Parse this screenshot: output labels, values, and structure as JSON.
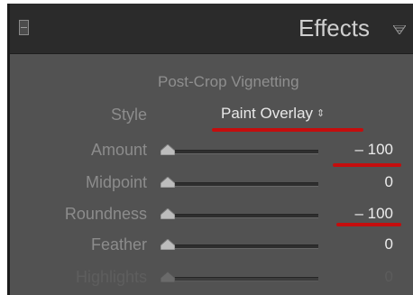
{
  "header": {
    "title": "Effects"
  },
  "vignetting": {
    "section_title": "Post-Crop Vignetting",
    "style": {
      "label": "Style",
      "value": "Paint Overlay"
    },
    "sliders": [
      {
        "label": "Amount",
        "value": "– 100",
        "position": 0.0,
        "enabled": true
      },
      {
        "label": "Midpoint",
        "value": "0",
        "position": 0.0,
        "enabled": true
      },
      {
        "label": "Roundness",
        "value": "– 100",
        "position": 0.0,
        "enabled": true
      },
      {
        "label": "Feather",
        "value": "0",
        "position": 0.0,
        "enabled": true
      },
      {
        "label": "Highlights",
        "value": "0",
        "position": 0.0,
        "enabled": false
      }
    ]
  },
  "colors": {
    "panel_header": "#2b2b2b",
    "panel_body": "#525252",
    "annotation_underline": "#c40d0d"
  }
}
